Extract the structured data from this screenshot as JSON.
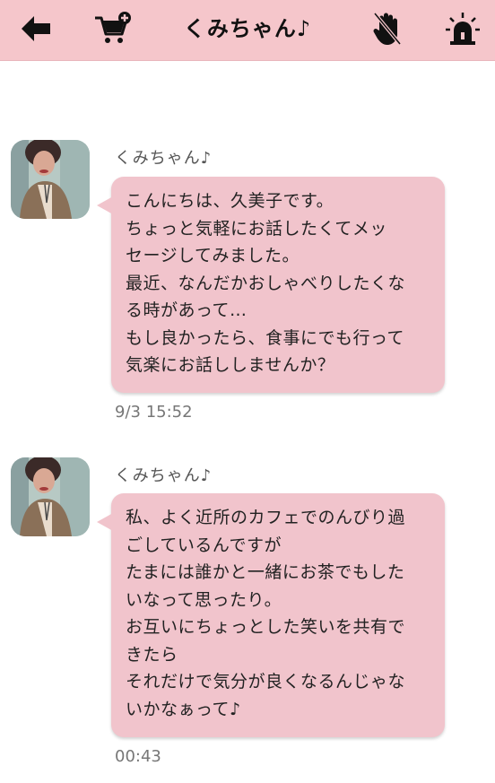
{
  "header": {
    "title": "くみちゃん♪",
    "back_icon": "back-arrow-icon",
    "cart_icon": "cart-add-icon",
    "block_icon": "block-hand-icon",
    "report_icon": "alarm-siren-icon",
    "background_color": "#f5c6cb"
  },
  "messages": [
    {
      "sender": "くみちゃん♪",
      "lines": [
        "こんにちは、久美子です。",
        "ちょっと気軽にお話したくてメッ",
        "セージしてみました。",
        "最近、なんだかおしゃべりしたくな",
        "る時があって…",
        "もし良かったら、食事にでも行って",
        "気楽にお話ししませんか？"
      ],
      "time": "9/3 15:52"
    },
    {
      "sender": "くみちゃん♪",
      "lines": [
        "私、よく近所のカフェでのんびり過",
        "ごしているんですが",
        "たまには誰かと一緒にお茶でもした",
        "いなって思ったり。",
        "お互いにちょっとした笑いを共有で",
        "きたら",
        "それだけで気分が良くなるんじゃな",
        "いかなぁって♪"
      ],
      "time": "00:43"
    }
  ],
  "colors": {
    "bubble": "#f1c4cc",
    "accent": "#f5c6cb"
  }
}
